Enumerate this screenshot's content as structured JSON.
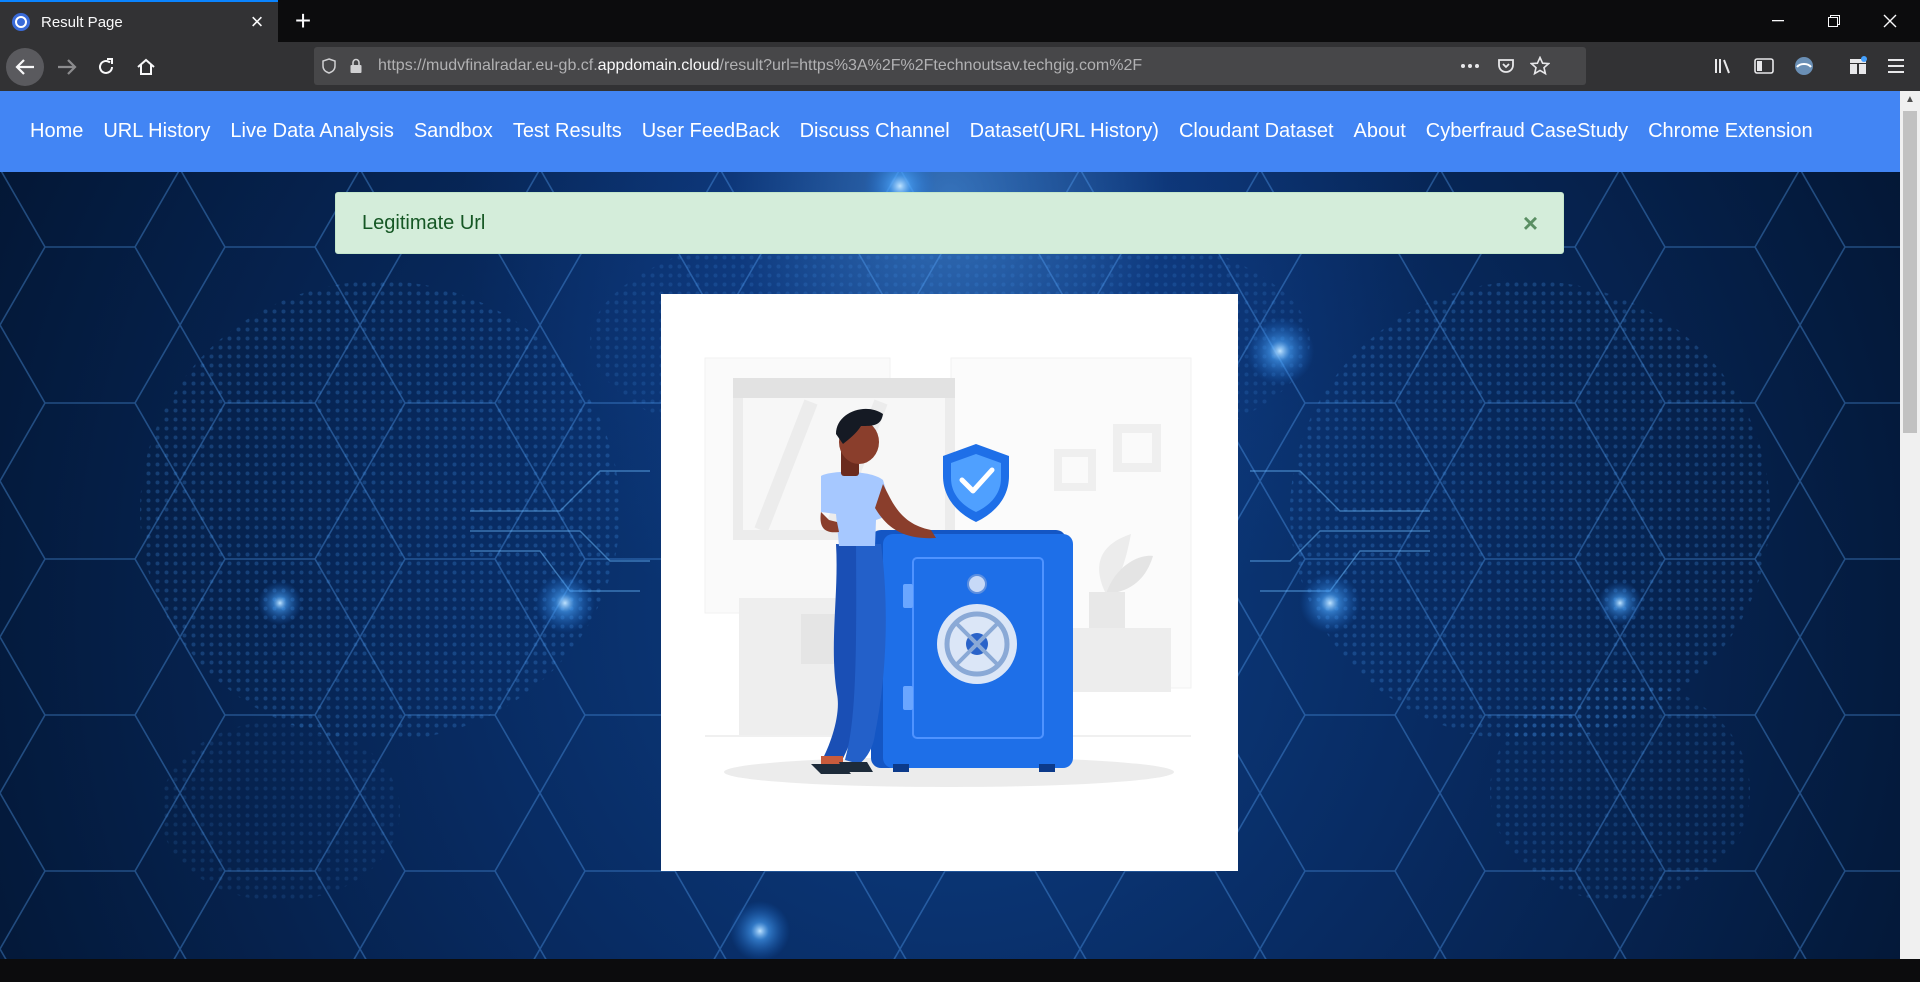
{
  "browser": {
    "tab_title": "Result Page",
    "url_prefix": "https://mudvfinalradar.eu-gb.cf.",
    "url_domain": "appdomain.cloud",
    "url_suffix": "/result?url=https%3A%2F%2Ftechnoutsav.techgig.com%2F"
  },
  "nav": {
    "items": [
      {
        "label": "Home"
      },
      {
        "label": "URL History"
      },
      {
        "label": "Live Data Analysis"
      },
      {
        "label": "Sandbox"
      },
      {
        "label": "Test Results"
      },
      {
        "label": "User FeedBack"
      },
      {
        "label": "Discuss Channel"
      },
      {
        "label": "Dataset(URL History)"
      },
      {
        "label": "Cloudant Dataset"
      },
      {
        "label": "About"
      },
      {
        "label": "Cyberfraud CaseStudy"
      },
      {
        "label": "Chrome Extension"
      }
    ]
  },
  "alert": {
    "message": "Legitimate Url",
    "close_glyph": "×"
  },
  "colors": {
    "nav_bg": "#4285f4",
    "alert_bg": "#d4edda",
    "alert_text": "#155724",
    "safe_blue": "#1e6fe8"
  },
  "icons": {
    "back": "arrow-left-icon",
    "forward": "arrow-right-icon",
    "reload": "reload-icon",
    "home": "home-icon",
    "shield": "tracking-shield-icon",
    "lock": "lock-icon",
    "more": "more-dots-icon",
    "pocket": "pocket-icon",
    "star": "bookmark-star-icon",
    "library": "library-icon",
    "sidebar": "sidebar-icon",
    "account": "account-icon",
    "extensions": "extensions-icon",
    "menu": "hamburger-menu-icon",
    "close_alert": "close-icon",
    "illustration": "safe-vault-illustration"
  }
}
